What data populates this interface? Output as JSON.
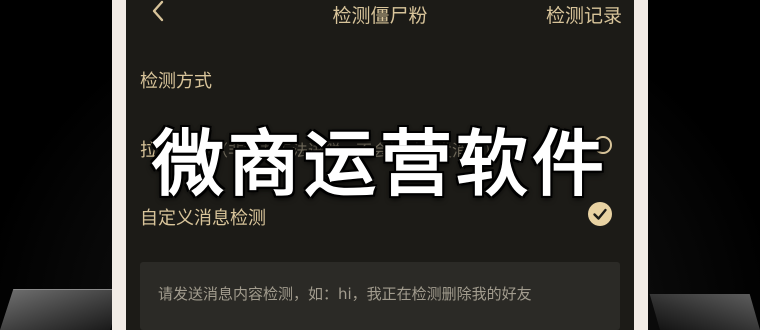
{
  "nav": {
    "back_icon": "chevron-left-icon",
    "title": "检测僵尸粉",
    "action_label": "检测记录"
  },
  "section": {
    "title": "检测方式"
  },
  "options": [
    {
      "label": "拉群检测",
      "note": "（非好友无法进群，不会给对方发消息）",
      "selected": false
    },
    {
      "label": "自定义消息检测",
      "selected": true
    }
  ],
  "message_box": {
    "text": "请发送消息内容检测，如：hi，我正在检测删除我的好友"
  },
  "overlay": {
    "caption": "微商运营软件"
  },
  "colors": {
    "accent_gold": "#d8c49a",
    "screen_bg": "#1c1b17",
    "check_fill": "#e8d2a2",
    "bezel": "#f2ece6"
  }
}
